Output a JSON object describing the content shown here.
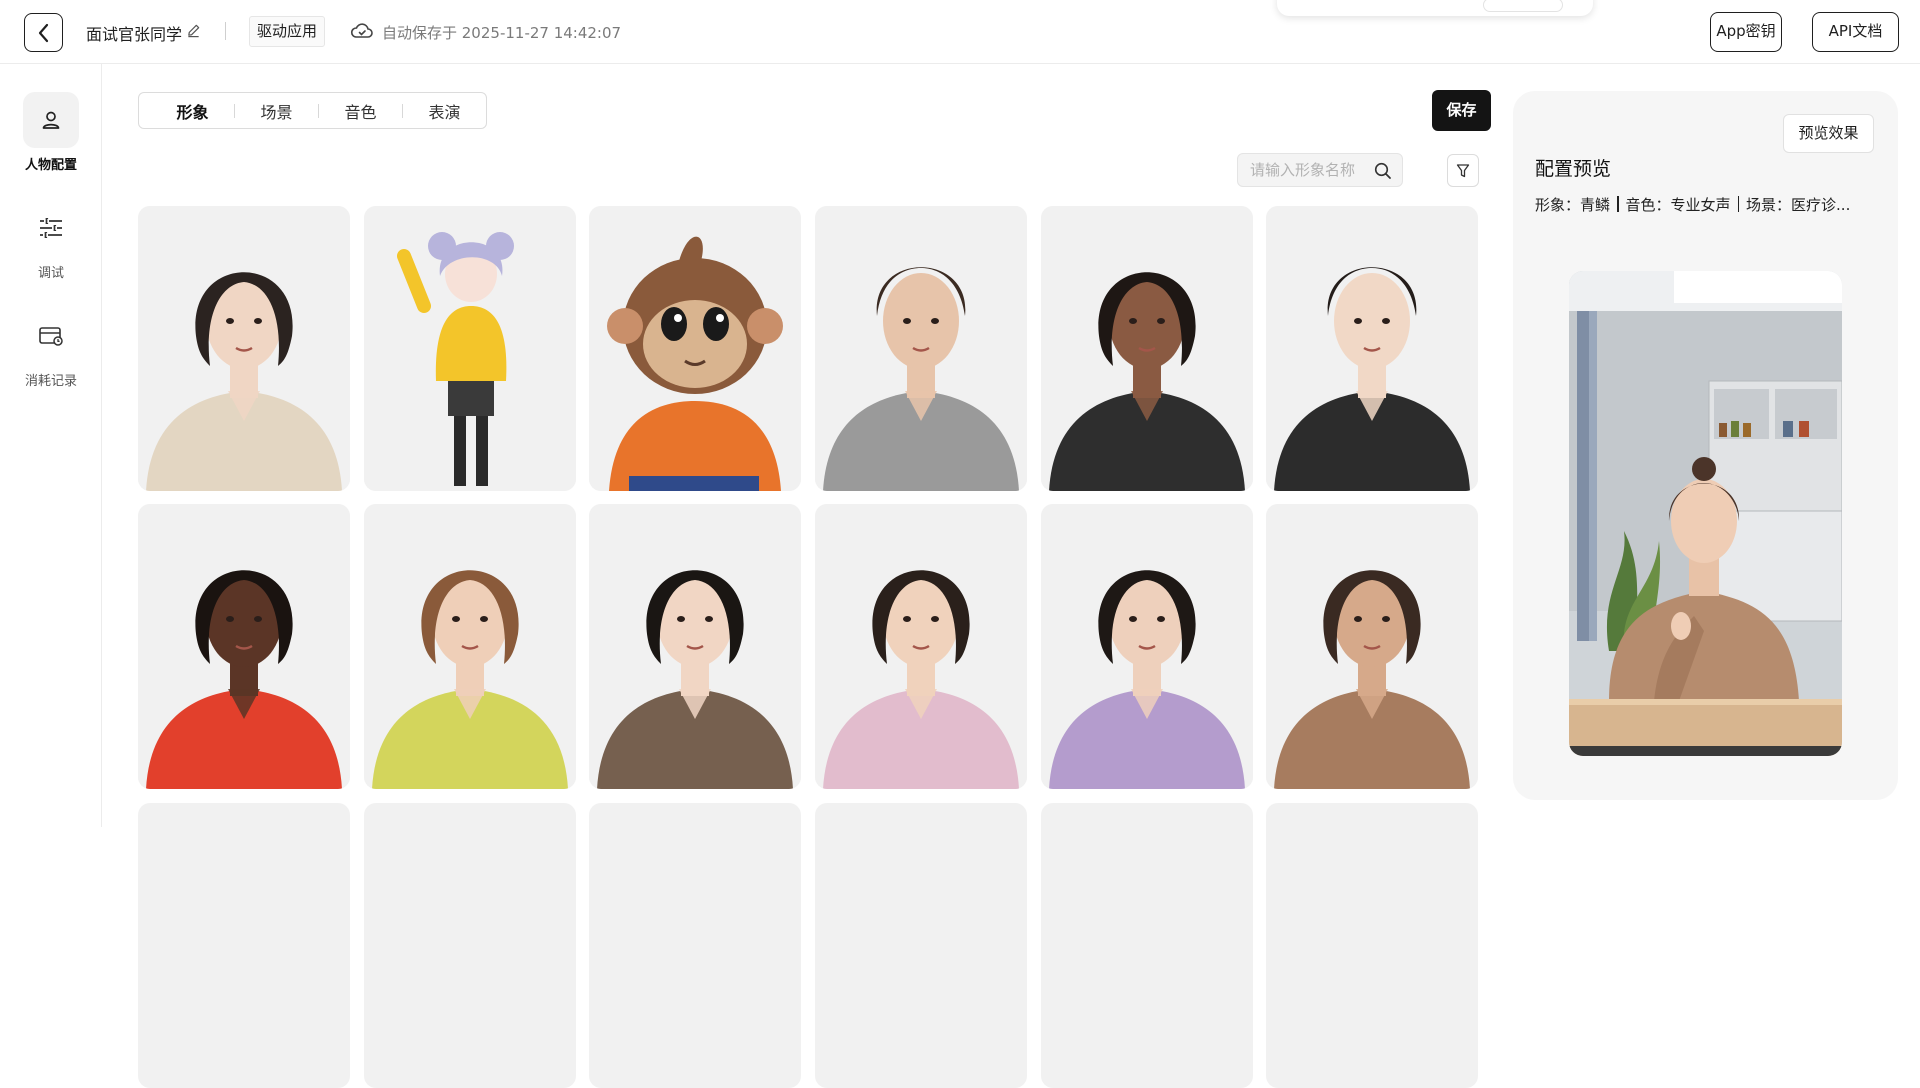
{
  "header": {
    "back_icon": "chevron-left-icon",
    "project_name": "面试官张同学",
    "edit_icon": "pencil-icon",
    "drive_app_label": "驱动应用",
    "cloud_icon": "cloud-icon",
    "autosave_text": "自动保存于 2025-11-27 14:42:07",
    "app_key_label": "App密钥",
    "api_doc_label": "API文档"
  },
  "sidebar": {
    "items": [
      {
        "icon": "person-icon",
        "label": "人物配置",
        "active": true
      },
      {
        "icon": "sliders-icon",
        "label": "调试",
        "active": false
      },
      {
        "icon": "card-icon",
        "label": "消耗记录",
        "active": false
      }
    ]
  },
  "tabs": [
    {
      "label": "形象",
      "active": true
    },
    {
      "label": "场景",
      "active": false
    },
    {
      "label": "音色",
      "active": false
    },
    {
      "label": "表演",
      "active": false
    }
  ],
  "save_label": "保存",
  "search": {
    "placeholder": "请输入形象名称",
    "icon": "search-icon"
  },
  "filter_icon": "filter-icon",
  "avatars": [
    {
      "style": "woman-beige-sweater",
      "skin": "#f0d6c4",
      "hair": "#2b2320",
      "top": "#e3d6c2"
    },
    {
      "style": "anime-girl-yellow",
      "skin": "#f7e1d8",
      "hair": "#b7b4dc",
      "top": "#f3c52a"
    },
    {
      "style": "monkey-orange-shirt",
      "skin": "#d9b48f",
      "hair": "#8a5a3b",
      "top": "#e8742b"
    },
    {
      "style": "man-grey-suit",
      "skin": "#e7c4aa",
      "hair": "#3b2b22",
      "top": "#9a9a9a"
    },
    {
      "style": "woman-black-leather",
      "skin": "#8a5a42",
      "hair": "#1e1714",
      "top": "#2e2e2e"
    },
    {
      "style": "boy-black-overalls",
      "skin": "#f1d8c6",
      "hair": "#241d1a",
      "top": "#2c2c2c"
    },
    {
      "style": "woman-red-top",
      "skin": "#5b3526",
      "hair": "#1a1310",
      "top": "#e2402c"
    },
    {
      "style": "woman-lime-jacket",
      "skin": "#efcfb8",
      "hair": "#8a5a3a",
      "top": "#d3d55c"
    },
    {
      "style": "woman-tweed-blazer",
      "skin": "#f1d6c4",
      "hair": "#1a1613",
      "top": "#76604f"
    },
    {
      "style": "woman-pink-blazer",
      "skin": "#f0d2bc",
      "hair": "#2a201b",
      "top": "#e2bccd"
    },
    {
      "style": "woman-lilac-top",
      "skin": "#eed0bc",
      "hair": "#1e1815",
      "top": "#b49ccd"
    },
    {
      "style": "woman-tan-jacket",
      "skin": "#d6a98a",
      "hair": "#3a2a22",
      "top": "#a77c5f"
    }
  ],
  "preview": {
    "button_label": "预览效果",
    "title": "配置预览",
    "avatar_label": "形象：青鳞",
    "voice_label": "音色：专业女声",
    "scene_label": "场景：医疗诊..."
  },
  "colors": {
    "accent": "#141414",
    "panel": "#f6f6f6",
    "card": "#f1f1f1"
  }
}
